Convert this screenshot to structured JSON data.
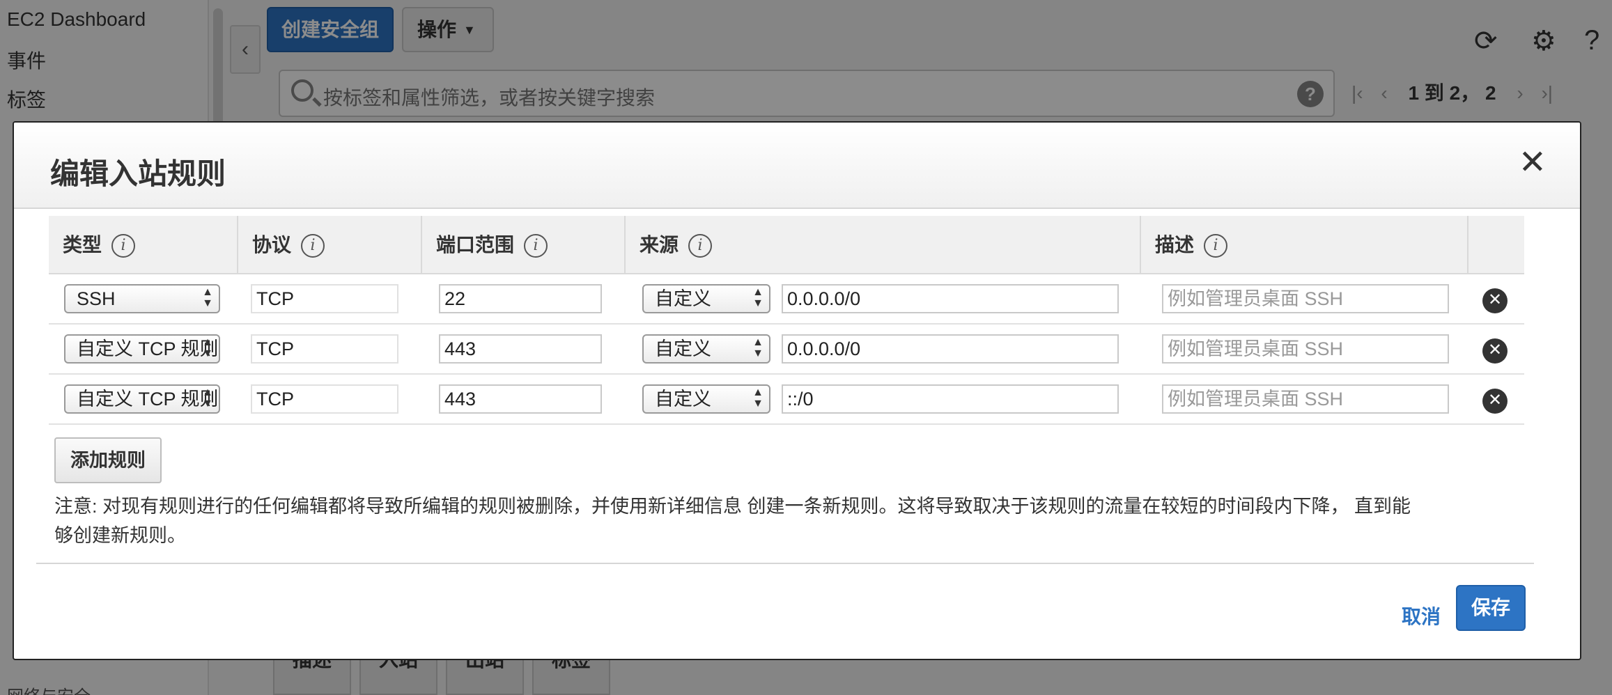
{
  "background": {
    "sidebar_items": [
      "EC2 Dashboard",
      "事件",
      "标签"
    ],
    "create_sg_label": "创建安全组",
    "actions_label": "操作",
    "search_placeholder": "按标签和属性筛选，或者按关键字搜索",
    "pager_count": "1 到 2， 2",
    "bottom_tabs": [
      "描述",
      "入站",
      "出站",
      "标签"
    ],
    "bottom_nav": "网络与安全"
  },
  "modal": {
    "title": "编辑入站规则",
    "columns": [
      "类型",
      "协议",
      "端口范围",
      "来源",
      "描述"
    ],
    "rows": [
      {
        "type": "SSH",
        "protocol": "TCP",
        "port": "22",
        "source_mode": "自定义",
        "cidr": "0.0.0.0/0",
        "description_placeholder": "例如管理员桌面 SSH"
      },
      {
        "type": "自定义 TCP 规则",
        "protocol": "TCP",
        "port": "443",
        "source_mode": "自定义",
        "cidr": "0.0.0.0/0",
        "description_placeholder": "例如管理员桌面 SSH"
      },
      {
        "type": "自定义 TCP 规则",
        "protocol": "TCP",
        "port": "443",
        "source_mode": "自定义",
        "cidr": "::/0",
        "description_placeholder": "例如管理员桌面 SSH"
      }
    ],
    "add_rule_label": "添加规则",
    "notice_line1": "注意: 对现有规则进行的任何编辑都将导致所编辑的规则被删除，并使用新详细信息 创建一条新规则。这将导致取决于该规则的流量在较短的时间段内下降， 直到能",
    "notice_line2": "够创建新规则。",
    "cancel_label": "取消",
    "save_label": "保存"
  }
}
